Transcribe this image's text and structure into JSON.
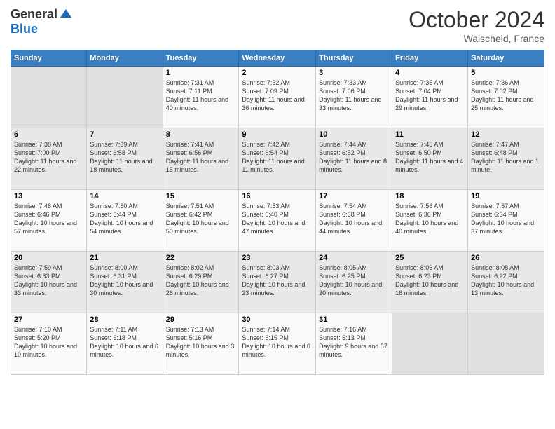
{
  "header": {
    "logo_general": "General",
    "logo_blue": "Blue",
    "month": "October 2024",
    "location": "Walscheid, France"
  },
  "days_of_week": [
    "Sunday",
    "Monday",
    "Tuesday",
    "Wednesday",
    "Thursday",
    "Friday",
    "Saturday"
  ],
  "weeks": [
    [
      {
        "day": "",
        "empty": true
      },
      {
        "day": "",
        "empty": true
      },
      {
        "day": "1",
        "sunrise": "7:31 AM",
        "sunset": "7:11 PM",
        "daylight": "11 hours and 40 minutes."
      },
      {
        "day": "2",
        "sunrise": "7:32 AM",
        "sunset": "7:09 PM",
        "daylight": "11 hours and 36 minutes."
      },
      {
        "day": "3",
        "sunrise": "7:33 AM",
        "sunset": "7:06 PM",
        "daylight": "11 hours and 33 minutes."
      },
      {
        "day": "4",
        "sunrise": "7:35 AM",
        "sunset": "7:04 PM",
        "daylight": "11 hours and 29 minutes."
      },
      {
        "day": "5",
        "sunrise": "7:36 AM",
        "sunset": "7:02 PM",
        "daylight": "11 hours and 25 minutes."
      }
    ],
    [
      {
        "day": "6",
        "sunrise": "7:38 AM",
        "sunset": "7:00 PM",
        "daylight": "11 hours and 22 minutes."
      },
      {
        "day": "7",
        "sunrise": "7:39 AM",
        "sunset": "6:58 PM",
        "daylight": "11 hours and 18 minutes."
      },
      {
        "day": "8",
        "sunrise": "7:41 AM",
        "sunset": "6:56 PM",
        "daylight": "11 hours and 15 minutes."
      },
      {
        "day": "9",
        "sunrise": "7:42 AM",
        "sunset": "6:54 PM",
        "daylight": "11 hours and 11 minutes."
      },
      {
        "day": "10",
        "sunrise": "7:44 AM",
        "sunset": "6:52 PM",
        "daylight": "11 hours and 8 minutes."
      },
      {
        "day": "11",
        "sunrise": "7:45 AM",
        "sunset": "6:50 PM",
        "daylight": "11 hours and 4 minutes."
      },
      {
        "day": "12",
        "sunrise": "7:47 AM",
        "sunset": "6:48 PM",
        "daylight": "11 hours and 1 minute."
      }
    ],
    [
      {
        "day": "13",
        "sunrise": "7:48 AM",
        "sunset": "6:46 PM",
        "daylight": "10 hours and 57 minutes."
      },
      {
        "day": "14",
        "sunrise": "7:50 AM",
        "sunset": "6:44 PM",
        "daylight": "10 hours and 54 minutes."
      },
      {
        "day": "15",
        "sunrise": "7:51 AM",
        "sunset": "6:42 PM",
        "daylight": "10 hours and 50 minutes."
      },
      {
        "day": "16",
        "sunrise": "7:53 AM",
        "sunset": "6:40 PM",
        "daylight": "10 hours and 47 minutes."
      },
      {
        "day": "17",
        "sunrise": "7:54 AM",
        "sunset": "6:38 PM",
        "daylight": "10 hours and 44 minutes."
      },
      {
        "day": "18",
        "sunrise": "7:56 AM",
        "sunset": "6:36 PM",
        "daylight": "10 hours and 40 minutes."
      },
      {
        "day": "19",
        "sunrise": "7:57 AM",
        "sunset": "6:34 PM",
        "daylight": "10 hours and 37 minutes."
      }
    ],
    [
      {
        "day": "20",
        "sunrise": "7:59 AM",
        "sunset": "6:33 PM",
        "daylight": "10 hours and 33 minutes."
      },
      {
        "day": "21",
        "sunrise": "8:00 AM",
        "sunset": "6:31 PM",
        "daylight": "10 hours and 30 minutes."
      },
      {
        "day": "22",
        "sunrise": "8:02 AM",
        "sunset": "6:29 PM",
        "daylight": "10 hours and 26 minutes."
      },
      {
        "day": "23",
        "sunrise": "8:03 AM",
        "sunset": "6:27 PM",
        "daylight": "10 hours and 23 minutes."
      },
      {
        "day": "24",
        "sunrise": "8:05 AM",
        "sunset": "6:25 PM",
        "daylight": "10 hours and 20 minutes."
      },
      {
        "day": "25",
        "sunrise": "8:06 AM",
        "sunset": "6:23 PM",
        "daylight": "10 hours and 16 minutes."
      },
      {
        "day": "26",
        "sunrise": "8:08 AM",
        "sunset": "6:22 PM",
        "daylight": "10 hours and 13 minutes."
      }
    ],
    [
      {
        "day": "27",
        "sunrise": "7:10 AM",
        "sunset": "5:20 PM",
        "daylight": "10 hours and 10 minutes."
      },
      {
        "day": "28",
        "sunrise": "7:11 AM",
        "sunset": "5:18 PM",
        "daylight": "10 hours and 6 minutes."
      },
      {
        "day": "29",
        "sunrise": "7:13 AM",
        "sunset": "5:16 PM",
        "daylight": "10 hours and 3 minutes."
      },
      {
        "day": "30",
        "sunrise": "7:14 AM",
        "sunset": "5:15 PM",
        "daylight": "10 hours and 0 minutes."
      },
      {
        "day": "31",
        "sunrise": "7:16 AM",
        "sunset": "5:13 PM",
        "daylight": "9 hours and 57 minutes."
      },
      {
        "day": "",
        "empty": true
      },
      {
        "day": "",
        "empty": true
      }
    ]
  ]
}
